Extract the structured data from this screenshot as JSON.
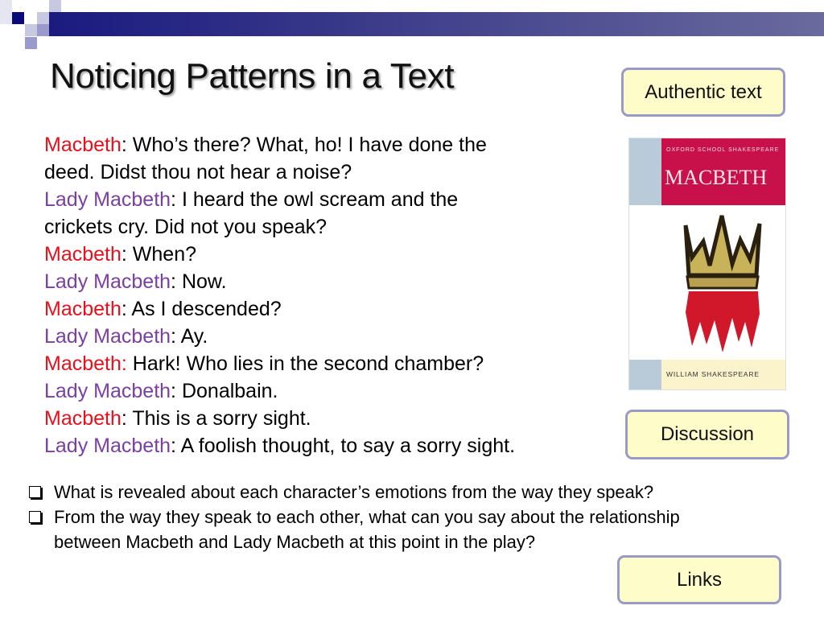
{
  "slide": {
    "title": "Noticing Patterns in a Text",
    "colors": {
      "macbeth": "#e8101c",
      "lady_macbeth": "#7a3fa0",
      "button_fill": "#fefcc8",
      "button_border": "#9a9ac8",
      "header_bar": "#1a1a80"
    },
    "dialogue": [
      {
        "speaker": "Macbeth",
        "sep": ": ",
        "text": "Who’s there? What, ho! I have done the",
        "cont": "deed. Didst thou not hear a noise?"
      },
      {
        "speaker": "Lady Macbeth",
        "sep": ": ",
        "text": "I heard the owl scream and the",
        "cont": "crickets cry. Did not you speak?"
      },
      {
        "speaker": "Macbeth",
        "sep": ": ",
        "text": "When?"
      },
      {
        "speaker": "Lady Macbeth",
        "sep": ": ",
        "text": "Now."
      },
      {
        "speaker": "Macbeth",
        "sep": ": ",
        "text": "As I descended?"
      },
      {
        "speaker": "Lady Macbeth",
        "sep": ": ",
        "text": "Ay."
      },
      {
        "speaker": "Macbeth:",
        "sep": " ",
        "text": "Hark! Who lies in the second chamber?"
      },
      {
        "speaker": "Lady Macbeth",
        "sep": ": ",
        "text": "Donalbain."
      },
      {
        "speaker": "Macbeth",
        "sep": ": ",
        "text": "This is a sorry sight."
      },
      {
        "speaker": "Lady Macbeth",
        "sep": ": ",
        "text": "A foolish thought, to say a sorry sight."
      }
    ],
    "questions": [
      {
        "line1": "What is revealed about each character’s emotions from the way they speak?"
      },
      {
        "line1": "From the way they speak to each other, what can you say about the relationship",
        "line2": "between Macbeth and Lady Macbeth at this point in the play?"
      }
    ],
    "buttons": {
      "authentic_text": "Authentic text",
      "discussion": "Discussion",
      "links": "Links"
    },
    "book_cover": {
      "series": "OXFORD SCHOOL SHAKESPEARE",
      "title": "MACBETH",
      "author": "WILLIAM SHAKESPEARE",
      "image": "crown-with-blood-reflection"
    }
  }
}
